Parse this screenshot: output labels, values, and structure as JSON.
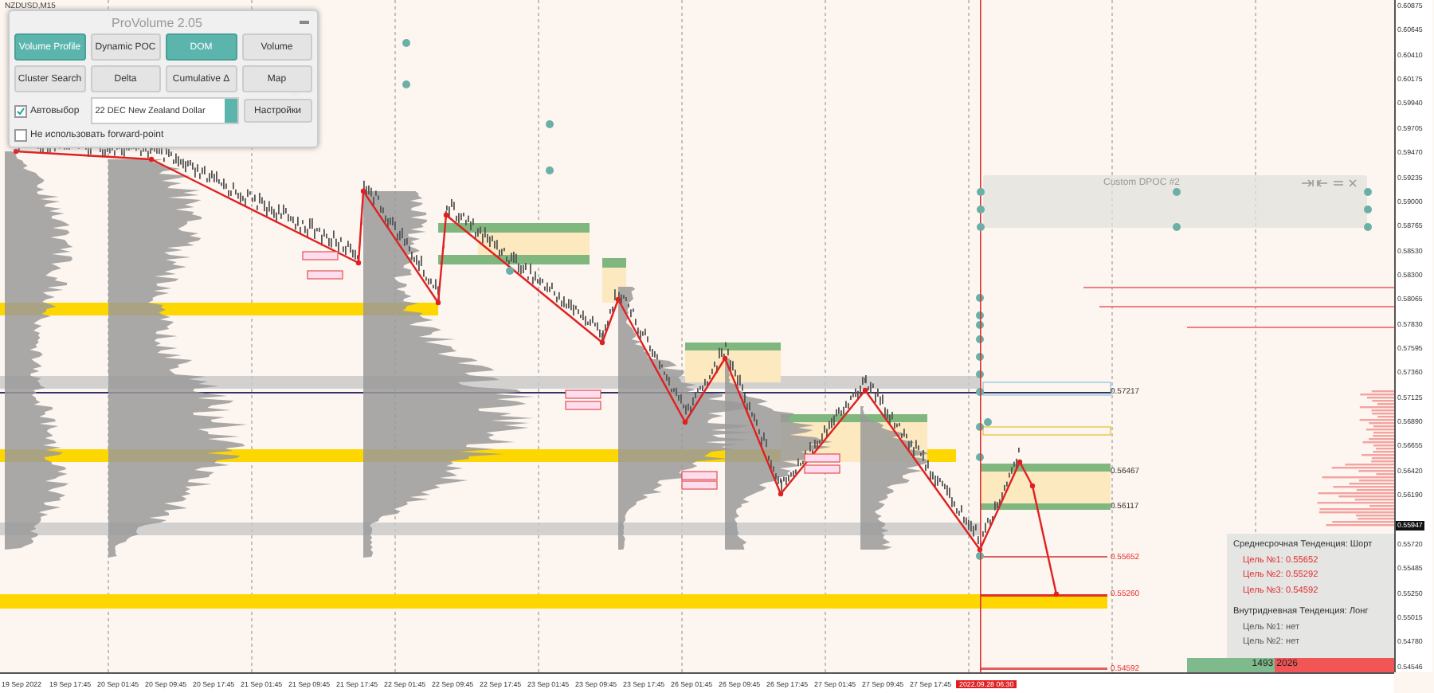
{
  "chart": {
    "symbol": "NZDUSD,M15"
  },
  "provolume": {
    "title": "ProVolume 2.05",
    "buttons": [
      {
        "label": "Volume Profile",
        "selected": true
      },
      {
        "label": "Dynamic POC",
        "selected": false
      },
      {
        "label": "DOM",
        "selected": true
      },
      {
        "label": "Volume",
        "selected": false
      },
      {
        "label": "Cluster Search",
        "selected": false
      },
      {
        "label": "Delta",
        "selected": false
      },
      {
        "label": "Cumulative Δ",
        "selected": false
      },
      {
        "label": "Map",
        "selected": false
      }
    ],
    "auto_select": {
      "label": "Автовыбор",
      "checked": true
    },
    "instrument": {
      "value": "22 DEC New Zealand Dollar"
    },
    "settings_button": "Настройки",
    "forward_point": {
      "label": "Не использовать forward-point",
      "checked": false
    }
  },
  "dpoc_panel": {
    "title": "Custom DPOC #2"
  },
  "level_labels": [
    {
      "text": "0.57217",
      "kind": "level"
    },
    {
      "text": "0.56467",
      "kind": "level"
    },
    {
      "text": "0.56117",
      "kind": "level"
    },
    {
      "text": "0.55652",
      "kind": "target"
    },
    {
      "text": "0.55260",
      "kind": "target"
    },
    {
      "text": "0.54592",
      "kind": "target"
    }
  ],
  "trend_box": {
    "sections": [
      {
        "heading": "Среднесрочная Тенденция: Шорт",
        "color": "#e03030",
        "targets": [
          "Цель №1: 0.55652",
          "Цель №2: 0.55292",
          "Цель №3: 0.54592"
        ]
      },
      {
        "heading": "Внутридневная Тенденция: Лонг",
        "color": "#555555",
        "targets": [
          "Цель №1: нет",
          "Цель №2: нет"
        ]
      }
    ]
  },
  "volume_bar": {
    "buy": "1493",
    "sell": "2026"
  },
  "price_axis": {
    "labels": [
      "0.60875",
      "0.60645",
      "0.60410",
      "0.60175",
      "0.59940",
      "0.59705",
      "0.59470",
      "0.59235",
      "0.59000",
      "0.58765",
      "0.58530",
      "0.58300",
      "0.58065",
      "0.57830",
      "0.57595",
      "0.57360",
      "0.57125",
      "0.56890",
      "0.56655",
      "0.56420",
      "0.56190",
      "0.55720",
      "0.55485",
      "0.55250",
      "0.55015",
      "0.54780",
      "0.54546"
    ],
    "current_price": "0.55947"
  },
  "time_axis": {
    "labels": [
      "19 Sep 2022",
      "19 Sep 17:45",
      "20 Sep 01:45",
      "20 Sep 09:45",
      "20 Sep 17:45",
      "21 Sep 01:45",
      "21 Sep 09:45",
      "21 Sep 17:45",
      "22 Sep 01:45",
      "22 Sep 09:45",
      "22 Sep 17:45",
      "23 Sep 01:45",
      "23 Sep 09:45",
      "23 Sep 17:45",
      "26 Sep 01:45",
      "26 Sep 09:45",
      "26 Sep 17:45",
      "27 Sep 01:45",
      "27 Sep 09:45",
      "27 Sep 17:45"
    ],
    "current_time": "2022.09.28 06:30"
  }
}
